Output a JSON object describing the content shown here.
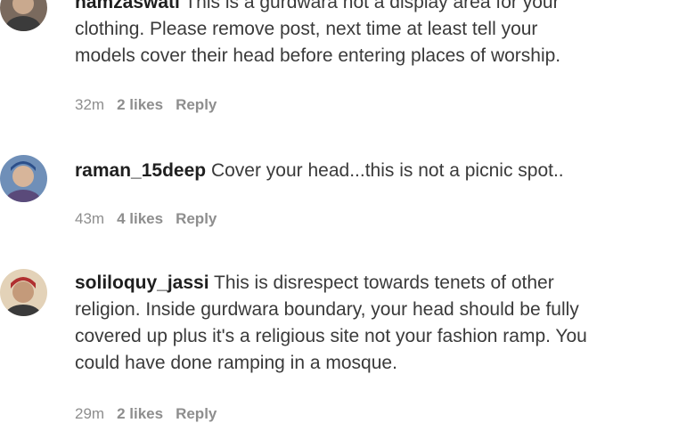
{
  "comments": [
    {
      "username": "namzaswati",
      "lines": [
        "This is a gurdwara not a display area for your",
        "clothing. Please remove post, next time at least tell your",
        "models cover their head before entering places of worship."
      ],
      "time": "32m",
      "likes": "2 likes",
      "reply": "Reply"
    },
    {
      "username": "raman_15deep",
      "lines": [
        "Cover your head...this is not a picnic spot.."
      ],
      "time": "43m",
      "likes": "4 likes",
      "reply": "Reply"
    },
    {
      "username": "soliloquy_jassi",
      "lines": [
        "This is disrespect towards tenets of other",
        "religion. Inside gurdwara boundary, your head should be fully",
        "covered up plus it's a religious site not your fashion ramp. You",
        "could have done ramping in a mosque."
      ],
      "time": "29m",
      "likes": "2 likes",
      "reply": "Reply"
    }
  ]
}
